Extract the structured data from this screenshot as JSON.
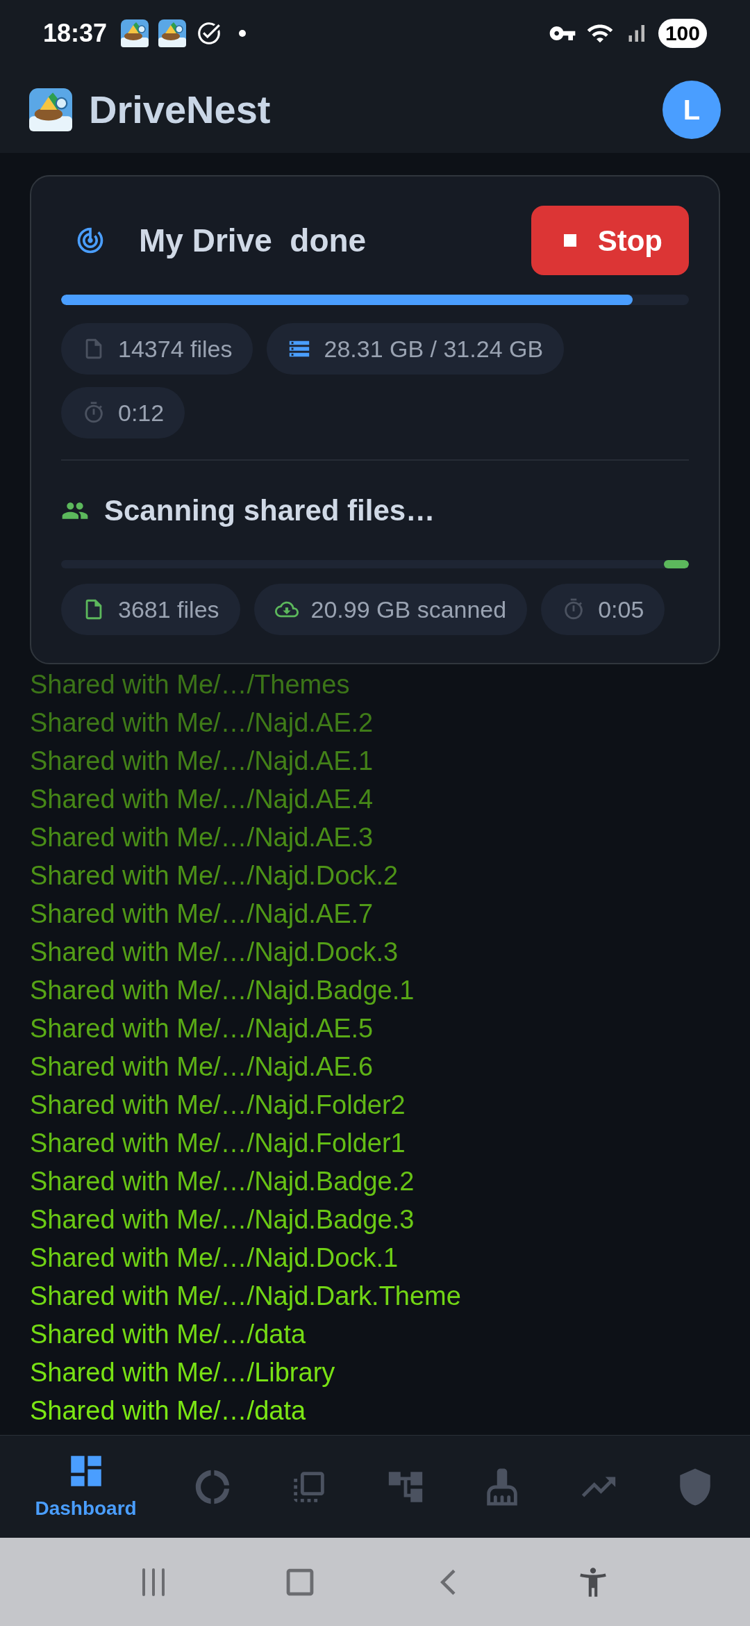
{
  "status_bar": {
    "time": "18:37",
    "battery": "100"
  },
  "header": {
    "title": "DriveNest",
    "avatar": "L"
  },
  "scan_card": {
    "drive": {
      "title": "My Drive  done",
      "level": 0.91,
      "stats": [
        {
          "kind": "files",
          "text": "14374 files"
        },
        {
          "kind": "storage",
          "text": "28.31 GB / 31.24 GB"
        },
        {
          "kind": "timer",
          "text": "0:12"
        }
      ]
    },
    "stop_button": "Stop",
    "shared": {
      "title": "Scanning shared files…",
      "level": 0.04,
      "stats": [
        {
          "kind": "files",
          "text": "3681 files"
        },
        {
          "kind": "download",
          "text": "20.99 GB scanned"
        },
        {
          "kind": "timer",
          "text": "0:05"
        }
      ]
    }
  },
  "log_lines": [
    "Shared with Me/…/Themes",
    "Shared with Me/…/Najd.AE.2",
    "Shared with Me/…/Najd.AE.1",
    "Shared with Me/…/Najd.AE.4",
    "Shared with Me/…/Najd.AE.3",
    "Shared with Me/…/Najd.Dock.2",
    "Shared with Me/…/Najd.AE.7",
    "Shared with Me/…/Najd.Dock.3",
    "Shared with Me/…/Najd.Badge.1",
    "Shared with Me/…/Najd.AE.5",
    "Shared with Me/…/Najd.AE.6",
    "Shared with Me/…/Najd.Folder2",
    "Shared with Me/…/Najd.Folder1",
    "Shared with Me/…/Najd.Badge.2",
    "Shared with Me/…/Najd.Badge.3",
    "Shared with Me/…/Najd.Dock.1",
    "Shared with Me/…/Najd.Dark.Theme",
    "Shared with Me/…/data",
    "Shared with Me/…/Library",
    "Shared with Me/…/data"
  ],
  "bottom_nav": [
    {
      "kind": "dashboard",
      "label": "Dashboard",
      "selected": true
    },
    {
      "kind": "donut",
      "selected": false
    },
    {
      "kind": "devices",
      "selected": false
    },
    {
      "kind": "tree",
      "selected": false
    },
    {
      "kind": "broom",
      "selected": false
    },
    {
      "kind": "trend",
      "selected": false
    },
    {
      "kind": "shield",
      "selected": false
    }
  ]
}
